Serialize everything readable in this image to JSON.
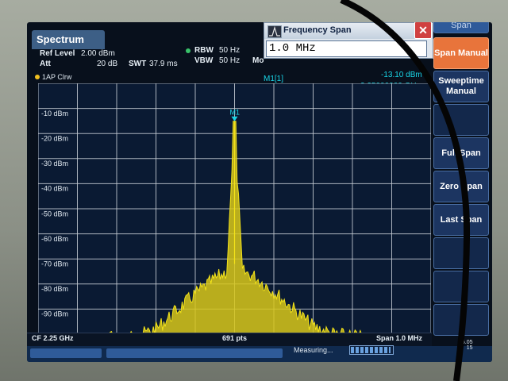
{
  "header": {
    "tab": "Spectrum",
    "ref_level_label": "Ref Level",
    "ref_level_value": "2.00 dBm",
    "att_label": "Att",
    "att_value": "20 dB",
    "swt_label": "SWT",
    "swt_value": "37.9 ms",
    "rbw_label": "RBW",
    "rbw_value": "50 Hz",
    "vbw_label": "VBW",
    "vbw_value": "50 Hz",
    "mode_label": "Mo"
  },
  "dialog": {
    "title": "Frequency Span",
    "value": "1.0 MHz",
    "close": "✕"
  },
  "trace_label": "1AP Clrw",
  "marker": {
    "name": "M1[1]",
    "level": "-13.10 dBm",
    "freq": "2.25000000 GHz",
    "tag": "M1"
  },
  "softkeys": {
    "top": "Span",
    "span_manual": "Span Manual",
    "sweeptime_manual": "Sweeptime Manual",
    "full_span": "Full Span",
    "zero_span": "Zero Span",
    "last_span": "Last Span"
  },
  "status": {
    "cf": "CF 2.25 GHz",
    "pts": "691 pts",
    "span": "Span 1.0 MHz",
    "measuring": "Measuring...",
    "date": "16.05",
    "time": "15"
  },
  "colors": {
    "trace": "#f2e21a",
    "marker": "#19d5e6",
    "grid": "#c8ced6",
    "active_softkey": "#e8743b"
  },
  "chart_data": {
    "type": "line",
    "ylabel_unit": "dBm",
    "y_ticks": [
      "-10 dBm",
      "-20 dBm",
      "-30 dBm",
      "-40 dBm",
      "-50 dBm",
      "-60 dBm",
      "-70 dBm",
      "-80 dBm",
      "-90 dBm"
    ],
    "ylim": [
      -98,
      2
    ],
    "xlim_mhz": [
      -0.5,
      0.5
    ],
    "center_freq": "2.25 GHz",
    "span": "1.0 MHz",
    "points": 691,
    "series": [
      {
        "x_mhz": [
          -0.5,
          -0.35,
          -0.25,
          -0.2,
          -0.15,
          -0.1,
          -0.05,
          -0.02,
          0,
          0.02,
          0.05,
          0.1,
          0.15,
          0.2,
          0.25,
          0.35,
          0.5
        ],
        "y_dbm": [
          -98,
          -97,
          -96,
          -93,
          -86,
          -79,
          -73,
          -70,
          -13.1,
          -70,
          -72,
          -78,
          -85,
          -92,
          -95,
          -97,
          -98
        ]
      }
    ],
    "marker": {
      "x_mhz": 0,
      "y_dbm": -13.1
    }
  }
}
